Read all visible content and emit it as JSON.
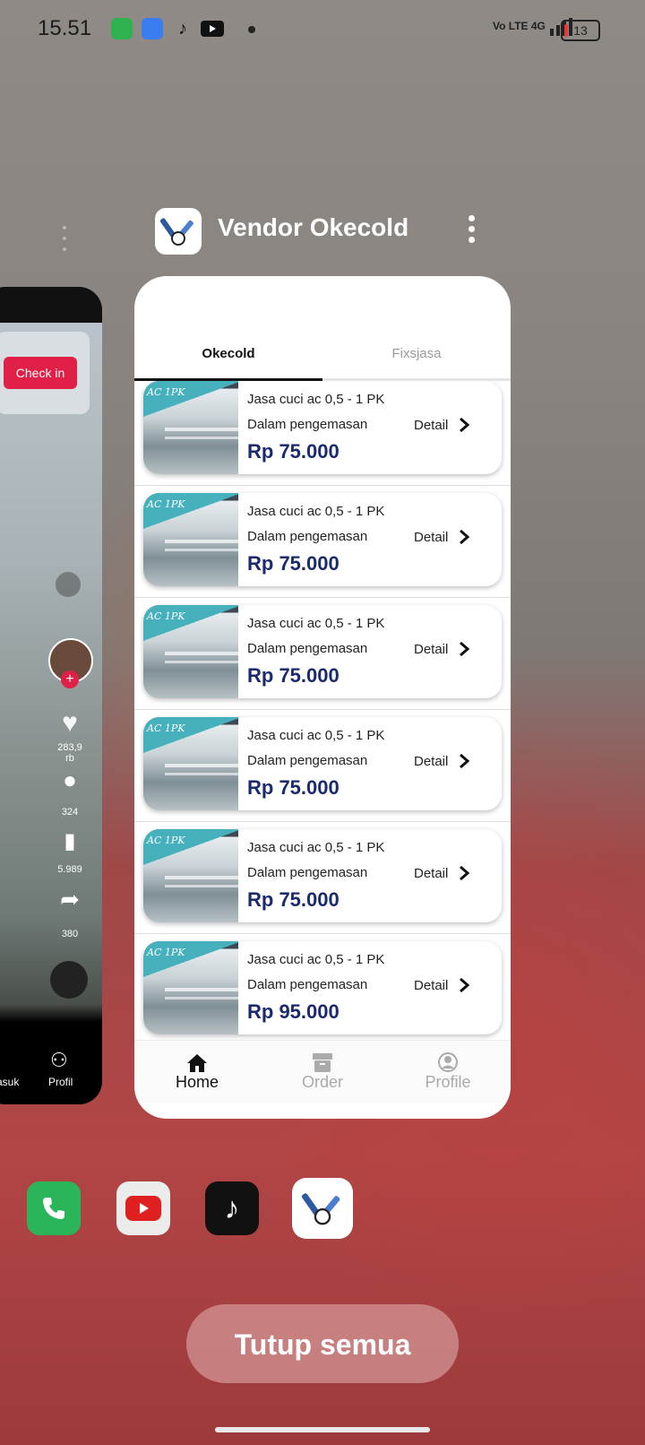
{
  "status_bar": {
    "time": "15.51",
    "network": "Vo LTE 4G",
    "battery": "13"
  },
  "left_app": {
    "checkin_label": "Check in",
    "likes": "283,9 rb",
    "comments": "324",
    "saves": "5.989",
    "shares": "380",
    "nav_masuk": "Masuk",
    "nav_profil": "Profil"
  },
  "app": {
    "title": "Vendor Okecold",
    "tabs": [
      {
        "label": "Okecold"
      },
      {
        "label": "Fixsjasa"
      }
    ],
    "items": [
      {
        "name": "Jasa cuci ac 0,5 - 1 PK",
        "status": "Dalam pengemasan",
        "price": "Rp 75.000",
        "detail": "Detail"
      },
      {
        "name": "Jasa cuci ac 0,5 - 1 PK",
        "status": "Dalam pengemasan",
        "price": "Rp 75.000",
        "detail": "Detail"
      },
      {
        "name": "Jasa cuci ac 0,5 - 1 PK",
        "status": "Dalam pengemasan",
        "price": "Rp 75.000",
        "detail": "Detail"
      },
      {
        "name": "Jasa cuci ac 0,5 - 1 PK",
        "status": "Dalam pengemasan",
        "price": "Rp 75.000",
        "detail": "Detail"
      },
      {
        "name": "Jasa cuci ac 0,5 - 1 PK",
        "status": "Dalam pengemasan",
        "price": "Rp 75.000",
        "detail": "Detail"
      },
      {
        "name": "Jasa cuci ac 0,5 - 1 PK",
        "status": "Dalam pengemasan",
        "price": "Rp 95.000",
        "detail": "Detail"
      }
    ],
    "thumb_text": "AC 1PK",
    "nav": [
      {
        "label": "Home"
      },
      {
        "label": "Order"
      },
      {
        "label": "Profile"
      }
    ]
  },
  "dock": [
    "phone-icon",
    "youtube-icon",
    "tiktok-icon",
    "vendor-okecold-icon"
  ],
  "close_all_label": "Tutup semua"
}
